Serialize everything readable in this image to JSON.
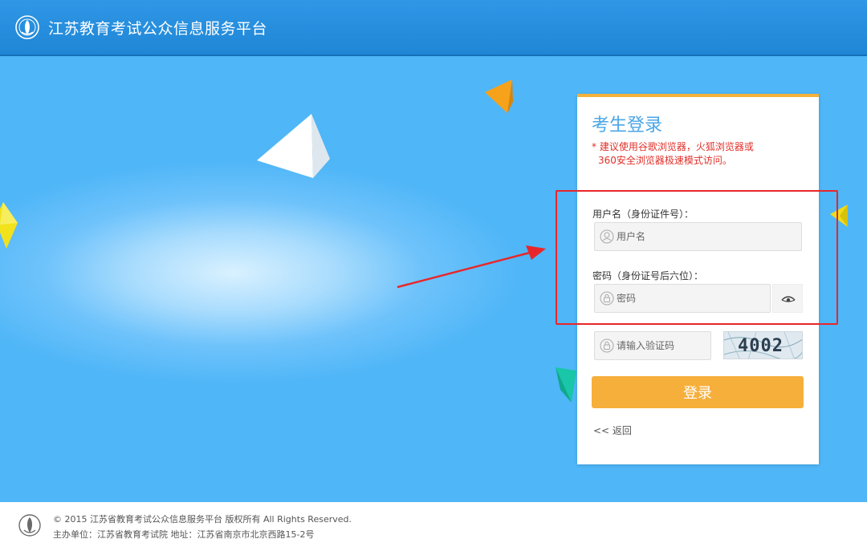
{
  "header": {
    "title": "江苏教育考试公众信息服务平台"
  },
  "login": {
    "title": "考生登录",
    "notice_line1": "* 建议使用谷歌浏览器，火狐浏览器或",
    "notice_line2": "360安全浏览器极速模式访问。",
    "username_label": "用户名（身份证件号）：",
    "username_placeholder": "用户名",
    "username_value": "",
    "password_label": "密码（身份证号后六位）：",
    "password_placeholder": "密码",
    "password_value": "",
    "captcha_placeholder": "请输入验证码",
    "captcha_value": "",
    "captcha_text": "4002",
    "submit_label": "登录",
    "back_label": "<< 返回"
  },
  "footer": {
    "copyright": "© 2015 江苏省教育考试公众信息服务平台 版权所有 All Rights Reserved.",
    "sponsor": "主办单位：江苏省教育考试院 地址：江苏省南京市北京西路15-2号"
  },
  "icons": {
    "logo": "emblem-icon",
    "user": "user-icon",
    "lock": "lock-icon",
    "eye": "eye-icon"
  },
  "colors": {
    "header_bg": "#1f86d6",
    "accent_orange": "#f6af3b",
    "title_blue": "#4aa6e6",
    "notice_red": "#e0302a",
    "annotation_red": "#e8262a"
  }
}
